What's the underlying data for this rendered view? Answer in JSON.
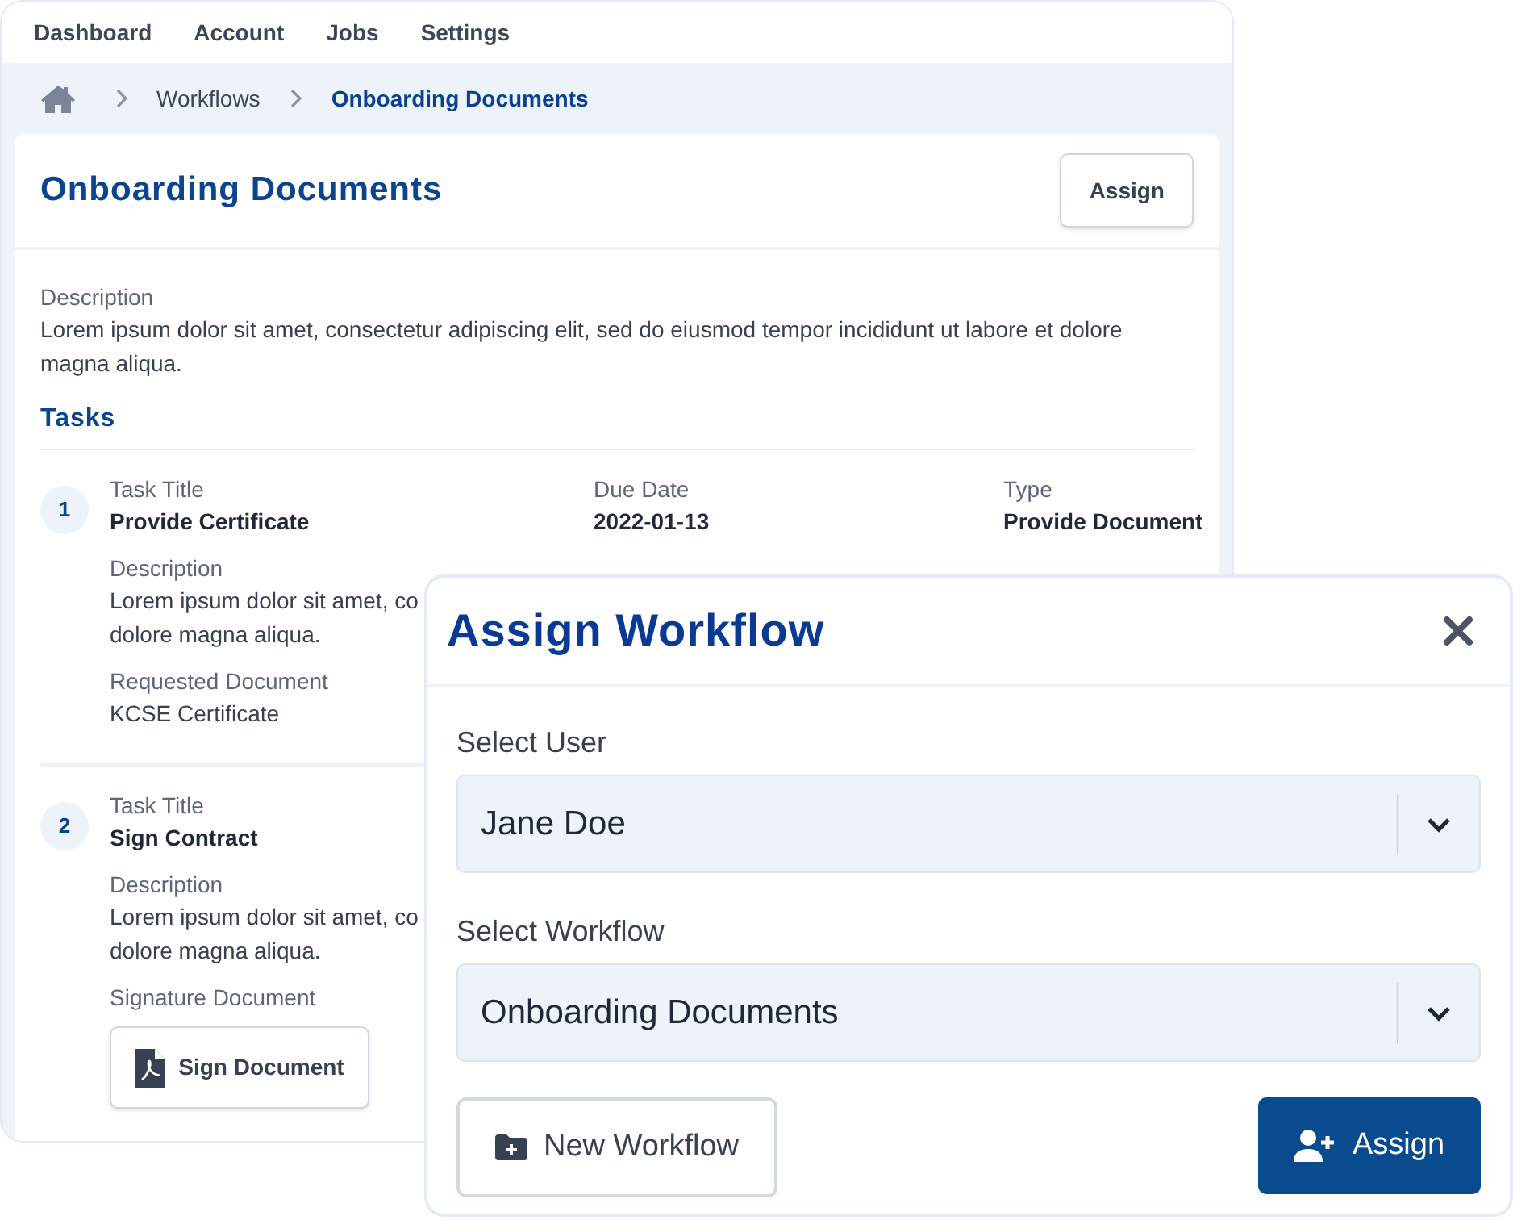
{
  "nav": [
    {
      "label": "Dashboard"
    },
    {
      "label": "Account"
    },
    {
      "label": "Jobs"
    },
    {
      "label": "Settings"
    }
  ],
  "breadcrumb": [
    {
      "label": "Workflows",
      "current": false
    },
    {
      "label": "Onboarding Documents",
      "current": true
    }
  ],
  "workflow": {
    "title": "Onboarding Documents",
    "assign_button": "Assign",
    "description_label": "Description",
    "description": "Lorem ipsum dolor sit amet, consectetur adipiscing elit, sed do eiusmod tempor incididunt ut labore et dolore magna aliqua.",
    "tasks_heading": "Tasks"
  },
  "tasks": [
    {
      "number": "1",
      "title_label": "Task Title",
      "title": "Provide Certificate",
      "due_label": "Due Date",
      "due": "2022-01-13",
      "type_label": "Type",
      "type": "Provide Document",
      "description_label": "Description",
      "description_lines": [
        "Lorem ipsum dolor sit amet, co",
        "dolore magna aliqua."
      ],
      "document_label": "Requested Document",
      "kind": "request",
      "document": "KCSE Certificate"
    },
    {
      "number": "2",
      "title_label": "Task Title",
      "title": "Sign Contract",
      "description_label": "Description",
      "description_lines": [
        "Lorem ipsum dolor sit amet, co",
        "dolore magna aliqua."
      ],
      "document_label": "Signature Document",
      "kind": "signature",
      "document": "Sign Document"
    }
  ],
  "modal": {
    "title": "Assign Workflow",
    "fields": [
      {
        "label": "Select User",
        "value": "Jane Doe"
      },
      {
        "label": "Select Workflow",
        "value": "Onboarding Documents"
      }
    ],
    "secondary_button": "New Workflow",
    "primary_button": "Assign"
  }
}
